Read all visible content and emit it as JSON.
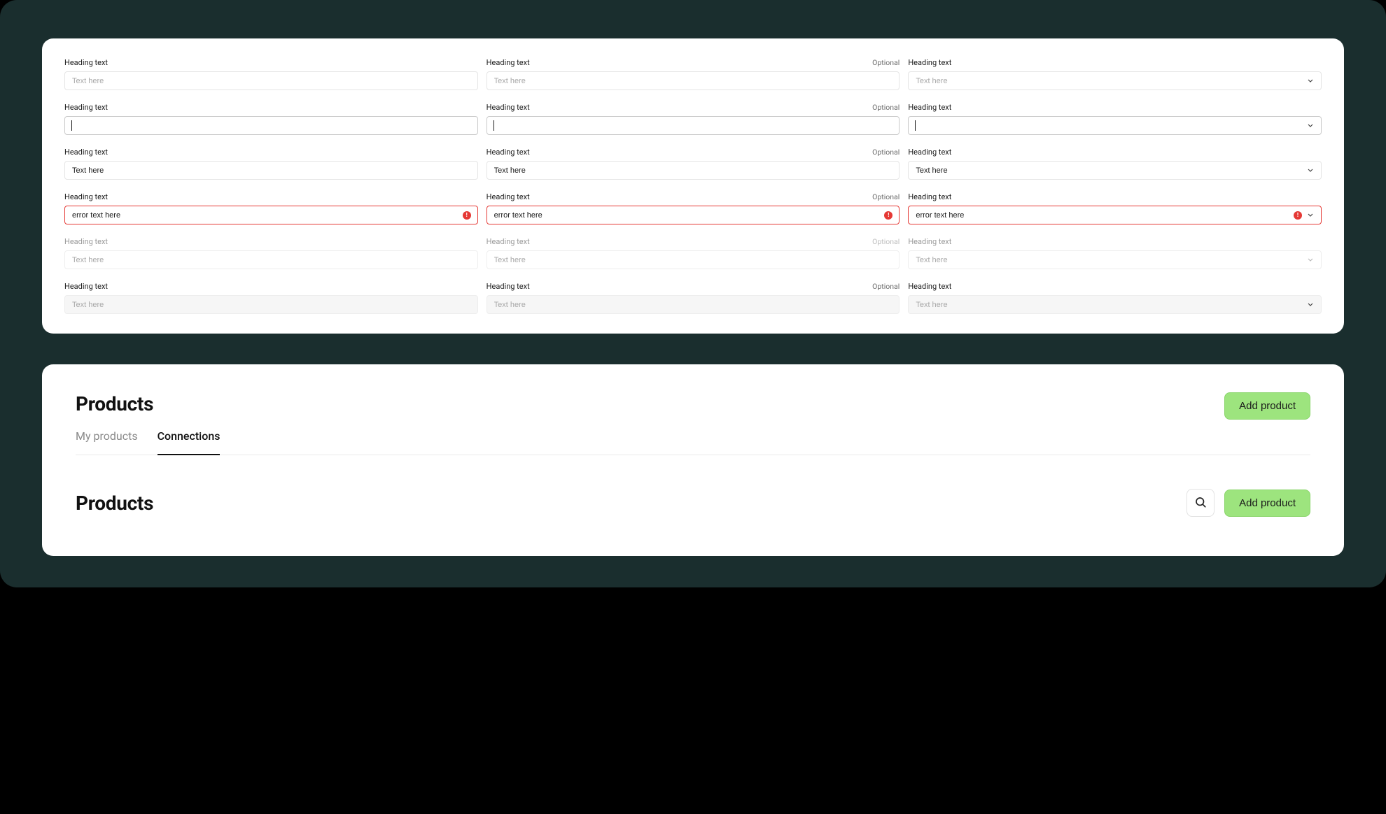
{
  "form": {
    "rows": [
      {
        "label": "Heading text",
        "optional_col2": "Optional",
        "placeholder": "Text here",
        "state": "default"
      },
      {
        "label": "Heading text",
        "optional_col2": "Optional",
        "value": "",
        "state": "focused"
      },
      {
        "label": "Heading text",
        "optional_col2": "Optional",
        "value": "Text here",
        "state": "filled"
      },
      {
        "label": "Heading text",
        "optional_col2": "Optional",
        "value": "error text here",
        "state": "error"
      },
      {
        "label": "Heading text",
        "optional_col2": "Optional",
        "placeholder": "Text here",
        "state": "disabled"
      },
      {
        "label": "Heading text",
        "optional_col2": "Optional",
        "placeholder": "Text here",
        "state": "readonly"
      }
    ],
    "optional_label": "Optional"
  },
  "section2": {
    "header1": {
      "title": "Products",
      "button": "Add product"
    },
    "tabs": [
      {
        "label": "My products",
        "active": false
      },
      {
        "label": "Connections",
        "active": true
      }
    ],
    "header2": {
      "title": "Products",
      "button": "Add product"
    }
  }
}
